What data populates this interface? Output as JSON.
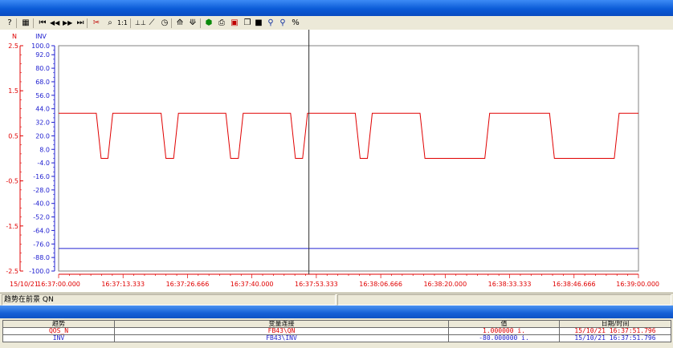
{
  "toolbar": {
    "buttons": [
      {
        "name": "help-icon",
        "glyph": "?"
      },
      {
        "name": "grid-icon",
        "glyph": "▦"
      },
      {
        "name": "first-icon",
        "glyph": "⏮"
      },
      {
        "name": "rewind-icon",
        "glyph": "◀◀"
      },
      {
        "name": "forward-icon",
        "glyph": "▶▶"
      },
      {
        "name": "last-icon",
        "glyph": "⏭"
      },
      {
        "name": "cursor-icon",
        "glyph": "✂"
      },
      {
        "name": "zoom-icon",
        "glyph": "⌕"
      },
      {
        "name": "zoom-reset-icon",
        "glyph": "1:1"
      },
      {
        "name": "axis-icon",
        "glyph": "⊥⊥"
      },
      {
        "name": "scale-icon",
        "glyph": "⟋"
      },
      {
        "name": "clock-icon",
        "glyph": "◷"
      },
      {
        "name": "trend-line-icon",
        "glyph": "⟰"
      },
      {
        "name": "trend-add-icon",
        "glyph": "⟱"
      },
      {
        "name": "run-icon",
        "glyph": "⬢"
      },
      {
        "name": "print-icon",
        "glyph": "⎙"
      },
      {
        "name": "print-preview-icon",
        "glyph": "▣"
      },
      {
        "name": "copy-icon",
        "glyph": "❐"
      },
      {
        "name": "save-icon",
        "glyph": "■"
      },
      {
        "name": "find-icon",
        "glyph": "⚲"
      },
      {
        "name": "find-next-icon",
        "glyph": "⚲"
      },
      {
        "name": "percent-icon",
        "glyph": "%"
      }
    ]
  },
  "chart_data": {
    "type": "line",
    "axes": {
      "left": {
        "label": "N",
        "ylim": [
          -2.5,
          2.5
        ],
        "ticks": [
          "2.5",
          "1.5",
          "0.5",
          "-0.5",
          "-1.5",
          "-2.5"
        ],
        "tick_values": [
          2.5,
          1.5,
          0.5,
          -0.5,
          -1.5,
          -2.5
        ],
        "color": "#e00000"
      },
      "right": {
        "label": "INV",
        "ylim": [
          -100,
          100
        ],
        "ticks": [
          "100.0",
          "92.0",
          "80.0",
          "68.0",
          "56.0",
          "44.0",
          "32.0",
          "20.0",
          "8.0",
          "-4.0",
          "-16.0",
          "-28.0",
          "-40.0",
          "-52.0",
          "-64.0",
          "-76.0",
          "-88.0",
          "-100.0"
        ],
        "tick_values": [
          100,
          92,
          80,
          68,
          56,
          44,
          32,
          20,
          8,
          -4,
          -16,
          -28,
          -40,
          -52,
          -64,
          -76,
          -88,
          -100
        ],
        "color": "#2020d0"
      }
    },
    "x": {
      "date_label": "15/10/21",
      "ticks": [
        "16:37:00.000",
        "16:37:13.333",
        "16:37:26.666",
        "16:37:40.000",
        "16:37:53.333",
        "16:38:06.666",
        "16:38:20.000",
        "16:38:33.333",
        "16:38:46.666",
        "16:39:00.000"
      ],
      "range_seconds": [
        0,
        120
      ]
    },
    "cursor_time": "16:37:51.796",
    "cursor_seconds": 51.796,
    "series": [
      {
        "name": "QOS_N",
        "axis": "left",
        "color": "#e00000",
        "points": [
          [
            0,
            1
          ],
          [
            7.8,
            1
          ],
          [
            8.8,
            0
          ],
          [
            10.2,
            0
          ],
          [
            11.2,
            1
          ],
          [
            21.2,
            1
          ],
          [
            22.2,
            0
          ],
          [
            23.8,
            0
          ],
          [
            24.8,
            1
          ],
          [
            34.6,
            1
          ],
          [
            35.6,
            0
          ],
          [
            37.2,
            0
          ],
          [
            38.2,
            1
          ],
          [
            48.0,
            1
          ],
          [
            49.0,
            0
          ],
          [
            50.5,
            0
          ],
          [
            51.5,
            1
          ],
          [
            61.4,
            1
          ],
          [
            62.4,
            0
          ],
          [
            63.9,
            0
          ],
          [
            64.9,
            1
          ],
          [
            74.8,
            1
          ],
          [
            75.8,
            0
          ],
          [
            88.2,
            0
          ],
          [
            89.2,
            1
          ],
          [
            101.6,
            1
          ],
          [
            102.6,
            0
          ],
          [
            115.0,
            0
          ],
          [
            116.0,
            1
          ],
          [
            120,
            1
          ]
        ]
      },
      {
        "name": "INV",
        "axis": "right",
        "color": "#2020d0",
        "points": [
          [
            0,
            -80
          ],
          [
            120,
            -80
          ]
        ]
      }
    ]
  },
  "status": {
    "message": "趋势在前景 QN"
  },
  "table": {
    "headers": [
      "趋势",
      "变量连接",
      "值",
      "日期/时间"
    ],
    "rows": [
      [
        "QOS_N",
        "FB43\\QN",
        "1.000000 i.",
        "15/10/21 16:37:51.796"
      ],
      [
        "INV",
        "FB43\\INV",
        "-80.000000 i.",
        "15/10/21 16:37:51.796"
      ]
    ]
  }
}
